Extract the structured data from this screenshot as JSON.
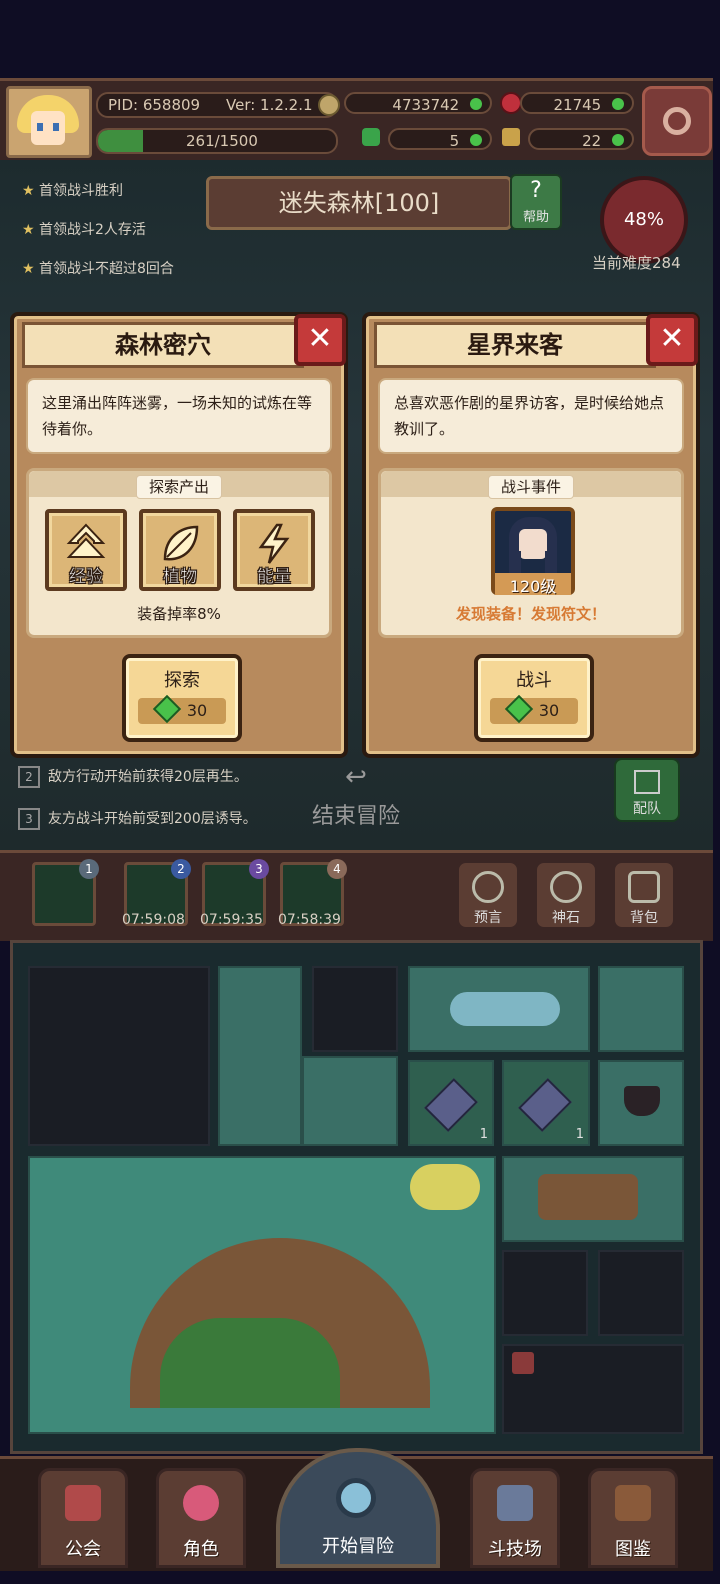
{
  "player": {
    "pid": "PID: 658809",
    "version": "Ver: 1.2.2.1",
    "exp": "261/1500",
    "coins": "4733742",
    "gems": "21745",
    "clover": "5",
    "key": "22"
  },
  "quests": [
    "首领战斗胜利",
    "首领战斗2人存活",
    "首领战斗不超过8回合"
  ],
  "area": {
    "title": "迷失森林[100]",
    "help_label": "帮助",
    "difficulty_pct": "48%",
    "difficulty_label": "当前难度284"
  },
  "dialog_left": {
    "title": "森林密穴",
    "close": "✕",
    "description": "这里涌出阵阵迷雾，一场未知的试炼在等待着你。",
    "section": "探索产出",
    "rewards": [
      "经验",
      "植物",
      "能量"
    ],
    "drop_rate": "装备掉率8%",
    "action": "探索",
    "cost": "30"
  },
  "dialog_right": {
    "title": "星界来客",
    "close": "✕",
    "description": "总喜欢恶作剧的星界访客，是时候给她点教训了。",
    "section": "战斗事件",
    "enemy_level": "120级",
    "discover": "发现装备！发现符文！",
    "action": "战斗",
    "cost": "30"
  },
  "rules": [
    {
      "num": "2",
      "text": "敌方行动开始前获得20层再生。"
    },
    {
      "num": "3",
      "text": "友方战斗开始前受到200层诱导。"
    }
  ],
  "end_adventure": "结束冒险",
  "team_label": "配队",
  "slots": [
    {
      "num": "1",
      "timer": ""
    },
    {
      "num": "2",
      "timer": "07:59:08"
    },
    {
      "num": "3",
      "timer": "07:59:35"
    },
    {
      "num": "4",
      "timer": "07:58:39"
    }
  ],
  "side_buttons": [
    "预言",
    "神石",
    "背包"
  ],
  "map_counts": [
    "1",
    "1"
  ],
  "nav": {
    "guild": "公会",
    "character": "角色",
    "start": "开始冒险",
    "arena": "斗技场",
    "codex": "图鉴"
  }
}
